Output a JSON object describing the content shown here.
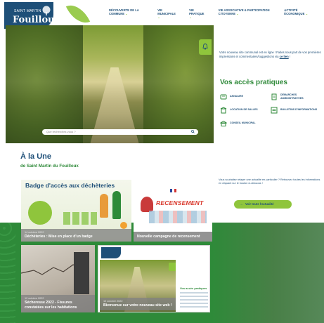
{
  "header": {
    "logo_line1": "SAINT MARTIN",
    "logo_line2": "Fouilloux",
    "nav": [
      {
        "label": "Découverte de la commune"
      },
      {
        "label": "Vie municipale"
      },
      {
        "label": "Vie pratique"
      },
      {
        "label": "Vie associative & participation citoyenne"
      },
      {
        "label": "Activité économique"
      }
    ],
    "chevron": "⌄"
  },
  "hero": {
    "search_placeholder": "Que recherchez-vous ?"
  },
  "notice": {
    "title": "Votre nouveau site communal est en ligne ! Faites nous part de vos premières impressions et commentaires/suggestions via",
    "link": "ce lien",
    "end": "!"
  },
  "access": {
    "title": "Vos accès pratiques",
    "items": [
      {
        "label": "Annuaire",
        "icon": "directory-icon"
      },
      {
        "label": "Démarches administratives",
        "icon": "documents-icon"
      },
      {
        "label": "Location de salles",
        "icon": "building-icon"
      },
      {
        "label": "Bulletins d'informations",
        "icon": "newsletter-icon"
      },
      {
        "label": "Conseil municipal",
        "icon": "council-icon"
      }
    ]
  },
  "une": {
    "title": "À la Une",
    "subtitle": "de Saint Martin du Fouilloux",
    "side_text": "Vous souhaitez relayer une actualité en particulier ? Retrouvez toutes les informations en cliquant sur le bouton ci-dessous !",
    "button": "Voir toute l'actualité",
    "button_arrow": "→"
  },
  "cards": [
    {
      "head": "Badge d'accès aux déchèteries",
      "date": "14 octobre 2022",
      "title": "Déchèteries : Mise en place d'un badge"
    },
    {
      "brand": "RECENSEMENT",
      "date": "",
      "title": "Nouvelle campagne de recensement"
    },
    {
      "date": "12 octobre 2022",
      "title": "Sécheresse 2022 - Fissures constatées sur les habitations"
    },
    {
      "date": "10 octobre 2022",
      "title": "Bienvenue sur votre nouveau site web !",
      "side": "Vos accès pratiques"
    }
  ],
  "colors": {
    "navy": "#1e4f78",
    "green": "#2f8a3a",
    "lime": "#8fc53c",
    "band": "#2e8a39"
  }
}
